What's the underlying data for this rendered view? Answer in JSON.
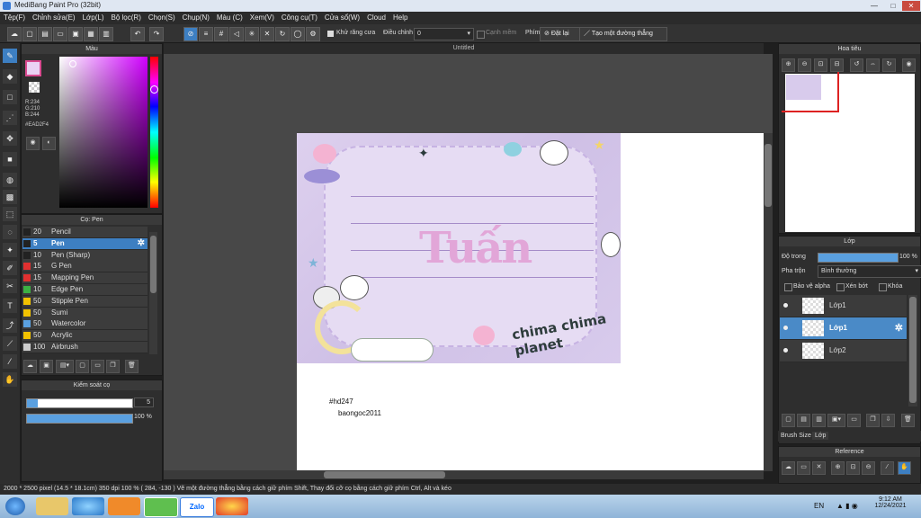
{
  "window": {
    "title": "MediBang Paint Pro (32bit)",
    "minimize": "—",
    "maximize": "□",
    "close": "✕"
  },
  "menu": [
    "Tệp(F)",
    "Chỉnh sửa(E)",
    "Lớp(L)",
    "Bộ lọc(R)",
    "Chọn(S)",
    "Chụp(N)",
    "Màu (C)",
    "Xem(V)",
    "Công cụ(T)",
    "Cửa sổ(W)",
    "Cloud",
    "Help"
  ],
  "toolbar": {
    "antialias_label": "Khử răng cưa",
    "adjust_label": "Điều chỉnh",
    "adjust_value": "0",
    "edge_label": "Cạnh mềm",
    "key_label": "Phím",
    "reset_label": "Đặt lại",
    "straight_line_label": "Tạo một đường thẳng"
  },
  "color_panel": {
    "title": "Màu",
    "r": "R:234",
    "g": "G:210",
    "b": "B:244",
    "hex": "#EAD2F4",
    "main_color": "#EAD2F4",
    "accent": "#d94a8f"
  },
  "brush_panel": {
    "title": "Cọ: Pen",
    "items": [
      {
        "size": "20",
        "name": "Pencil",
        "color": "#222222"
      },
      {
        "size": "5",
        "name": "Pen",
        "color": "#222222"
      },
      {
        "size": "10",
        "name": "Pen (Sharp)",
        "color": "#222222"
      },
      {
        "size": "15",
        "name": "G Pen",
        "color": "#e03030"
      },
      {
        "size": "15",
        "name": "Mapping Pen",
        "color": "#e03030"
      },
      {
        "size": "10",
        "name": "Edge Pen",
        "color": "#3cb043"
      },
      {
        "size": "50",
        "name": "Stipple Pen",
        "color": "#f2c200"
      },
      {
        "size": "50",
        "name": "Sumi",
        "color": "#f2c200"
      },
      {
        "size": "50",
        "name": "Watercolor",
        "color": "#5aa0e0"
      },
      {
        "size": "50",
        "name": "Acrylic",
        "color": "#f2c200"
      },
      {
        "size": "100",
        "name": "Airbrush",
        "color": "#cccccc"
      }
    ],
    "selected_index": 1
  },
  "brush_control": {
    "title": "Kiểm soát cọ",
    "size_value": "5",
    "opacity_value": "100 %",
    "size_fraction": 0.1,
    "opacity_fraction": 1.0
  },
  "canvas": {
    "tab_title": "Untitled",
    "watermark": "Tuấn",
    "sticker_text": "chima chima planet",
    "note1": "#hd247",
    "note2": "baongoc2011"
  },
  "navigator": {
    "title": "Hoa tiêu"
  },
  "layer_panel": {
    "title": "Lớp",
    "opacity_label": "Độ trong",
    "opacity_value": "100 %",
    "blend_label": "Pha trộn",
    "blend_value": "Bình thường",
    "protect_alpha": "Bảo vệ alpha",
    "clip": "Xén bớt",
    "lock": "Khóa",
    "layers": [
      "Lớp1",
      "Lớp1",
      "Lớp2"
    ],
    "selected_index": 1,
    "tabs": [
      "Brush Size",
      "Lớp"
    ]
  },
  "reference_panel": {
    "title": "Reference"
  },
  "statusbar": {
    "text": "2000 * 2500 pixel   (14.5 * 18.1cm)   350 dpi   100 %   ( 284, -130 )   Vẽ một đường thẳng bằng cách giữ phím Shift, Thay đổi cỡ cọ bằng cách giữ phím Ctrl, Alt và kéo"
  },
  "taskbar": {
    "lang": "EN",
    "time": "9:12 AM",
    "date": "12/24/2021",
    "zalo": "Zalo"
  }
}
